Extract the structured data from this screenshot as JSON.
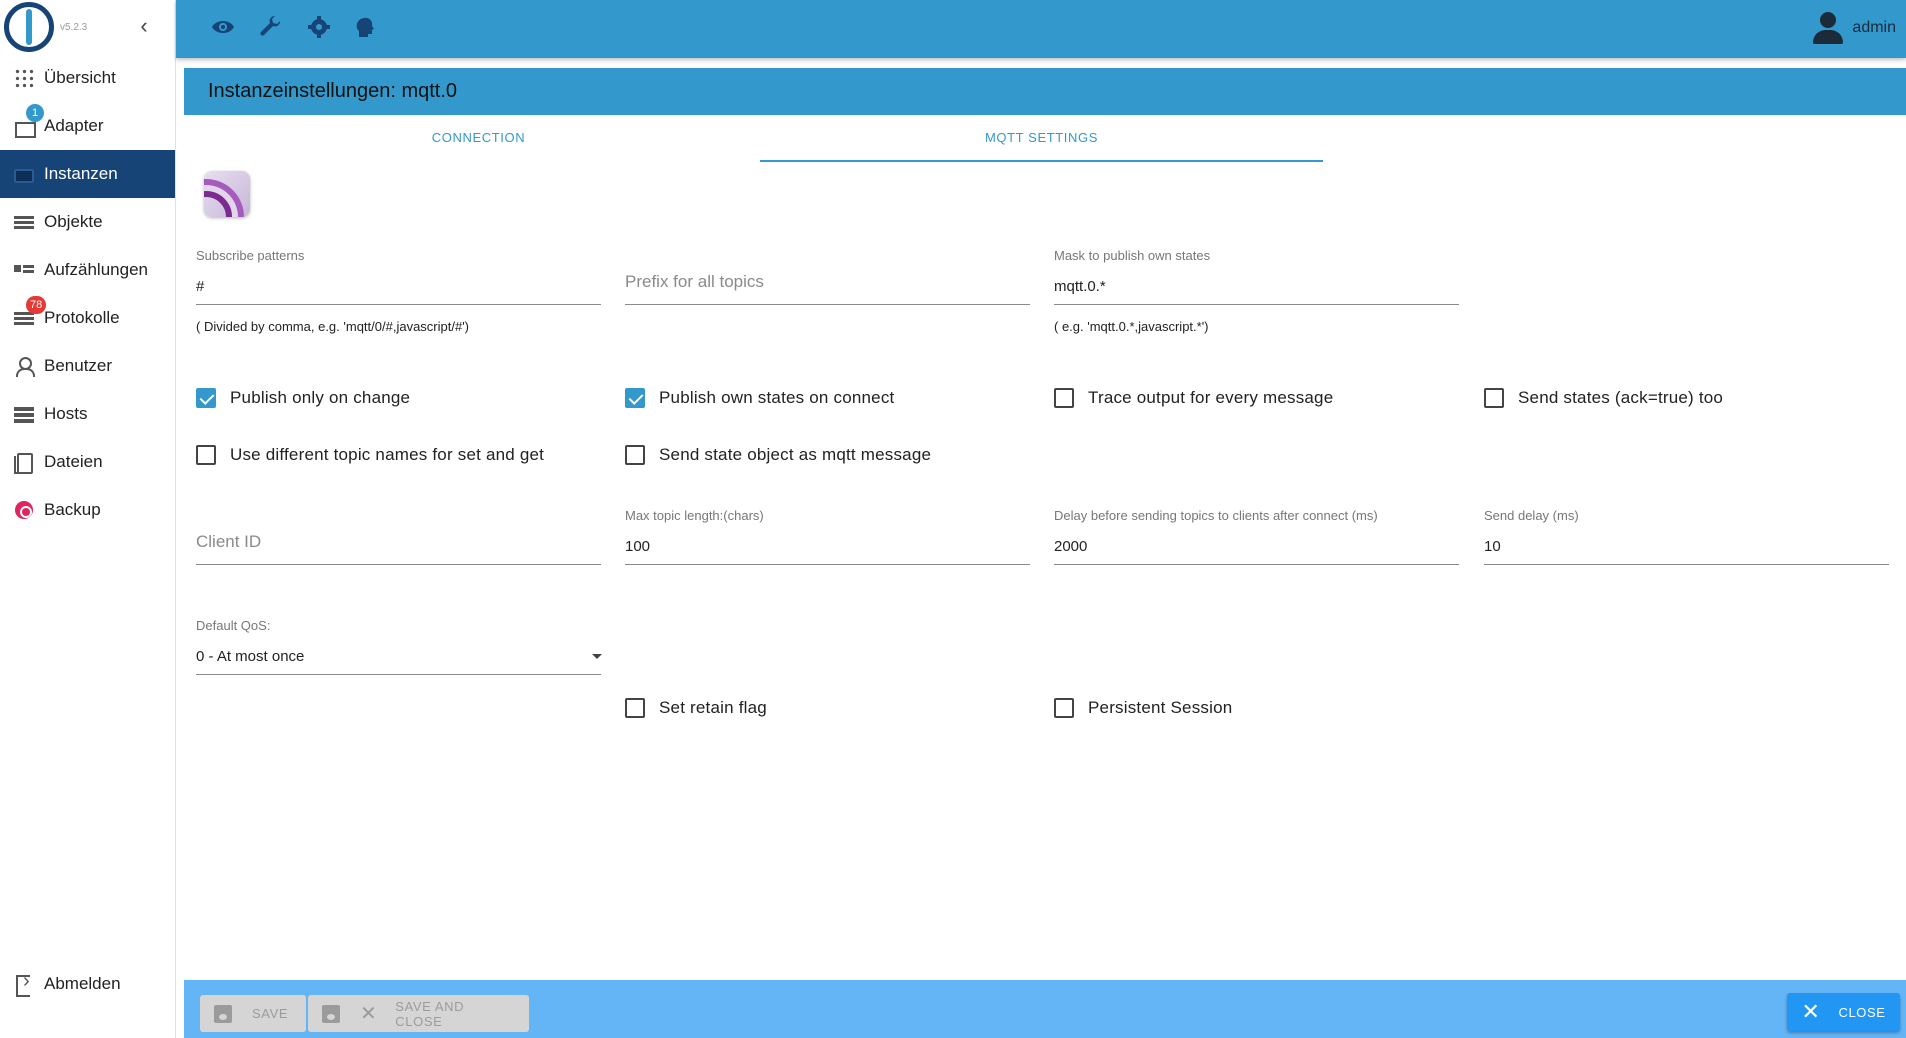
{
  "app": {
    "version": "v5.2.3",
    "collapse_glyph": "‹"
  },
  "sidebar": {
    "items": [
      {
        "label": "Übersicht",
        "icon": "grid-icon"
      },
      {
        "label": "Adapter",
        "icon": "store-icon",
        "badge": "1"
      },
      {
        "label": "Instanzen",
        "icon": "instances-icon",
        "active": true
      },
      {
        "label": "Objekte",
        "icon": "list-icon"
      },
      {
        "label": "Aufzählungen",
        "icon": "enum-icon"
      },
      {
        "label": "Protokolle",
        "icon": "log-icon",
        "badge": "78"
      },
      {
        "label": "Benutzer",
        "icon": "user-icon"
      },
      {
        "label": "Hosts",
        "icon": "hosts-icon"
      },
      {
        "label": "Dateien",
        "icon": "files-icon"
      },
      {
        "label": "Backup",
        "icon": "backup-icon"
      }
    ],
    "logout_label": "Abmelden"
  },
  "topbar": {
    "icons": [
      "eye-icon",
      "wrench-icon",
      "settings-icon",
      "expert-head-icon"
    ],
    "user": "admin"
  },
  "panel": {
    "title": "Instanzeinstellungen: mqtt.0",
    "tabs": [
      {
        "label": "CONNECTION",
        "active": false
      },
      {
        "label": "MQTT SETTINGS",
        "active": true
      }
    ]
  },
  "form": {
    "subscribe": {
      "label": "Subscribe patterns",
      "value": "#",
      "helper": "( Divided by comma, e.g. 'mqtt/0/#,javascript/#')"
    },
    "prefix": {
      "placeholder": "Prefix for all topics"
    },
    "mask": {
      "label": "Mask to publish own states",
      "value": "mqtt.0.*",
      "helper": "( e.g. 'mqtt.0.*,javascript.*')"
    },
    "checkboxes_row1": [
      {
        "label": "Publish only on change",
        "checked": true
      },
      {
        "label": "Publish own states on connect",
        "checked": true
      },
      {
        "label": "Trace output for every message",
        "checked": false
      },
      {
        "label": "Send states (ack=true) too",
        "checked": false
      }
    ],
    "checkboxes_row2": [
      {
        "label": "Use different topic names for set and get",
        "checked": false
      },
      {
        "label": "Send state object as mqtt message",
        "checked": false
      }
    ],
    "client_id": {
      "placeholder": "Client ID"
    },
    "max_topic_length": {
      "label": "Max topic length:(chars)",
      "value": "100"
    },
    "delay_connect": {
      "label": "Delay before sending topics to clients after connect (ms)",
      "value": "2000"
    },
    "send_delay": {
      "label": "Send delay (ms)",
      "value": "10"
    },
    "default_qos": {
      "label": "Default QoS:",
      "value": "0 - At most once"
    },
    "retain": {
      "label": "Set retain flag",
      "checked": false
    },
    "persistent": {
      "label": "Persistent Session",
      "checked": false
    }
  },
  "footer": {
    "save_label": "SAVE",
    "save_close_label": "SAVE AND CLOSE",
    "close_label": "CLOSE"
  }
}
